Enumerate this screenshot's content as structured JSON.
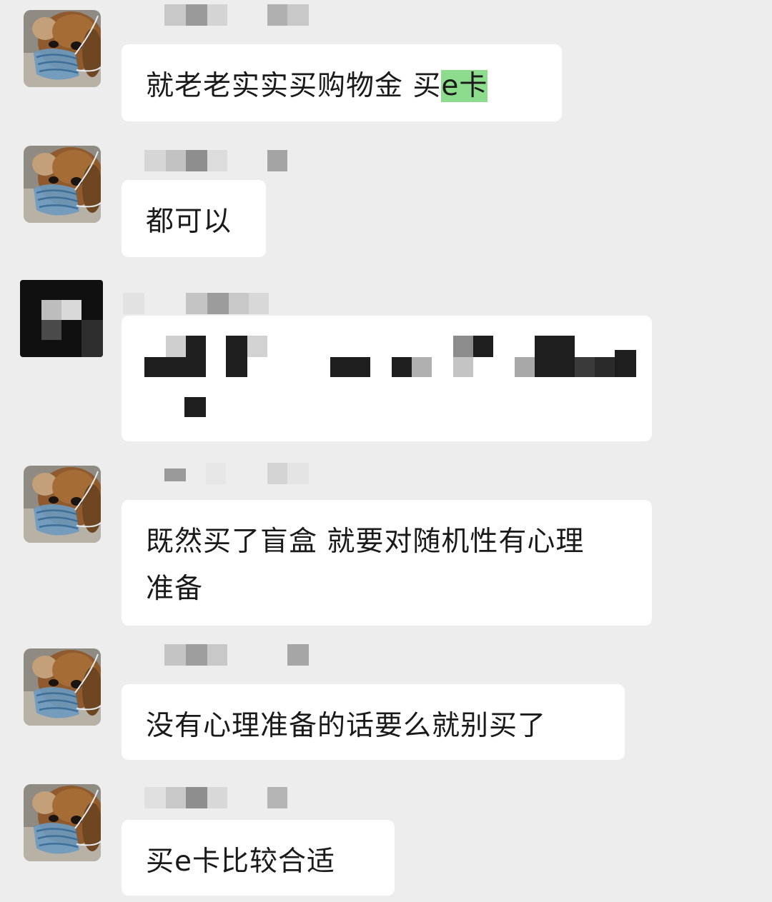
{
  "chat": {
    "messages": [
      {
        "id": "m1",
        "text_before": "就老老实实买购物金 买",
        "text_highlight": "e卡",
        "avatar_icon": "dog-with-mask-avatar"
      },
      {
        "id": "m2",
        "text": "都可以",
        "avatar_icon": "dog-with-mask-avatar"
      },
      {
        "id": "m3",
        "text": "",
        "redacted": true,
        "avatar_icon": "pixelated-avatar"
      },
      {
        "id": "m4",
        "text_line1": "既然买了盲盒 就要对随机性有心理",
        "text_line2": "准备",
        "avatar_icon": "dog-with-mask-avatar"
      },
      {
        "id": "m5",
        "text": "没有心理准备的话要么就别买了",
        "avatar_icon": "dog-with-mask-avatar"
      },
      {
        "id": "m6",
        "text": "买e卡比较合适",
        "avatar_icon": "dog-with-mask-avatar"
      }
    ]
  },
  "colors": {
    "background": "#ededed",
    "bubble": "#ffffff",
    "highlight": "#8ddb8d",
    "text": "#1a1a1a"
  }
}
